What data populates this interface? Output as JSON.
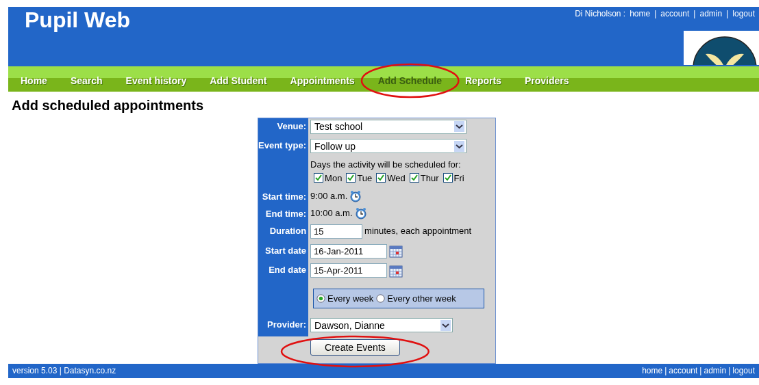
{
  "header": {
    "title": "Pupil Web",
    "user": "Di Nicholson :",
    "separator": "|",
    "links": [
      "home",
      "account",
      "admin",
      "logout"
    ]
  },
  "nav": [
    {
      "label": "Home",
      "selected": false,
      "circled": false
    },
    {
      "label": "Search",
      "selected": false,
      "circled": false
    },
    {
      "label": "Event history",
      "selected": false,
      "circled": false
    },
    {
      "label": "Add Student",
      "selected": false,
      "circled": false
    },
    {
      "label": "Appointments",
      "selected": false,
      "circled": false
    },
    {
      "label": "Add Schedule",
      "selected": true,
      "circled": true
    },
    {
      "label": "Reports",
      "selected": false,
      "circled": false
    },
    {
      "label": "Providers",
      "selected": false,
      "circled": false
    }
  ],
  "page_title": "Add scheduled appointments",
  "form": {
    "rows": [
      {
        "kind": "select",
        "label": "Venue:",
        "value": "Test school"
      },
      {
        "kind": "select",
        "label": "Event type:",
        "value": "Follow up"
      },
      {
        "kind": "days",
        "text": "Days the activity will be scheduled for:",
        "days": [
          {
            "label": "Mon",
            "checked": true
          },
          {
            "label": "Tue",
            "checked": true
          },
          {
            "label": "Wed",
            "checked": true
          },
          {
            "label": "Thur",
            "checked": true
          },
          {
            "label": "Fri",
            "checked": true
          }
        ]
      },
      {
        "kind": "time",
        "label": "Start time:",
        "value": "9:00 a.m."
      },
      {
        "kind": "time",
        "label": "End time:",
        "value": "10:00 a.m."
      },
      {
        "kind": "number",
        "label": "Duration",
        "value": "15",
        "suffix": "minutes, each appointment"
      },
      {
        "kind": "date",
        "label": "Start date",
        "value": "16-Jan-2011"
      },
      {
        "kind": "date",
        "label": "End date",
        "value": "15-Apr-2011"
      },
      {
        "kind": "radios",
        "options": [
          {
            "label": "Every week",
            "selected": true
          },
          {
            "label": "Every other week",
            "selected": false
          }
        ]
      },
      {
        "kind": "provider",
        "label": "Provider:",
        "value": "Dawson, Dianne"
      }
    ],
    "button": {
      "label": "Create Events",
      "circled": true
    }
  },
  "footer": {
    "version": "version 5.03 | Datasyn.co.nz",
    "separator": "|",
    "links": [
      "home",
      "account",
      "admin",
      "logout"
    ]
  }
}
